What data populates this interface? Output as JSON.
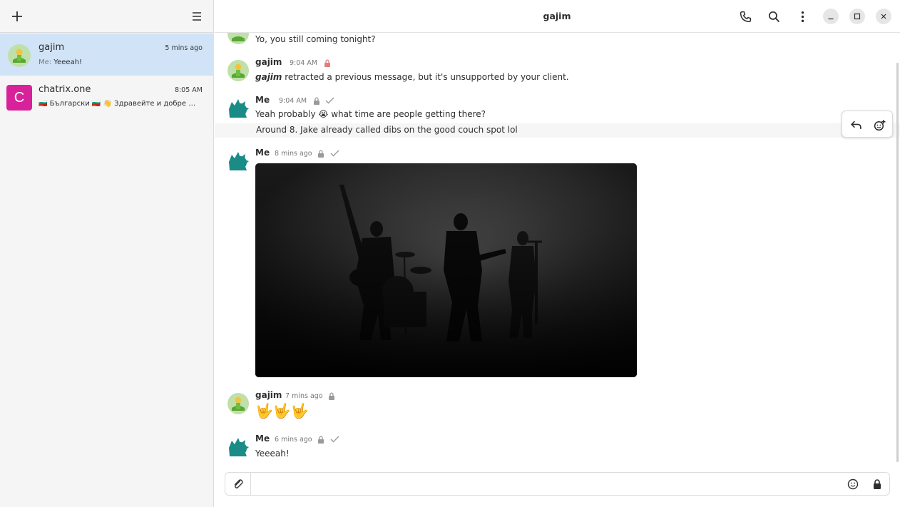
{
  "window": {
    "title": "gajim"
  },
  "sidebar": {
    "add_icon": "plus-icon",
    "menu_icon": "hamburger-menu-icon",
    "chats": [
      {
        "name": "gajim",
        "time": "5 mins ago",
        "preview_prefix": "Me:",
        "preview": "Yeeeah!",
        "selected": true
      },
      {
        "name": "chatrix.one",
        "time": "8:05 AM",
        "avatar_letter": "C",
        "avatar_color": "#d8229a",
        "preview": "🇧🇬 Български 🇧🇬 👋 Здравейте и добре …"
      }
    ]
  },
  "header": {
    "icons": [
      "phone-icon",
      "search-icon",
      "more-vert-icon",
      "minimize-icon",
      "maximize-icon",
      "close-icon"
    ]
  },
  "messages": [
    {
      "text": "Yo, you still coming tonight?"
    },
    {
      "sender": "gajim",
      "time": "9:04 AM",
      "actor": "gajim",
      "text": "retracted a previous message, but it's unsupported by your client."
    },
    {
      "sender": "Me",
      "time": "9:04 AM",
      "text": "Yeah probably 😭 what time are people getting there?"
    },
    {
      "text": "Around 8. Jake already called dibs on the good couch spot lol"
    },
    {
      "sender": "Me",
      "time": "8 mins ago"
    },
    {
      "sender": "gajim",
      "time": "7 mins ago",
      "text": "🤟🤟🤟"
    },
    {
      "sender": "Me",
      "time": "6 mins ago",
      "text": "Yeeeah!"
    }
  ],
  "composer": {
    "value": "",
    "placeholder": ""
  },
  "colors": {
    "selected_row": "#d1e3f7",
    "sidebar_bg": "#f5f5f5",
    "encrypted_lock_red": "#e27d7d"
  }
}
